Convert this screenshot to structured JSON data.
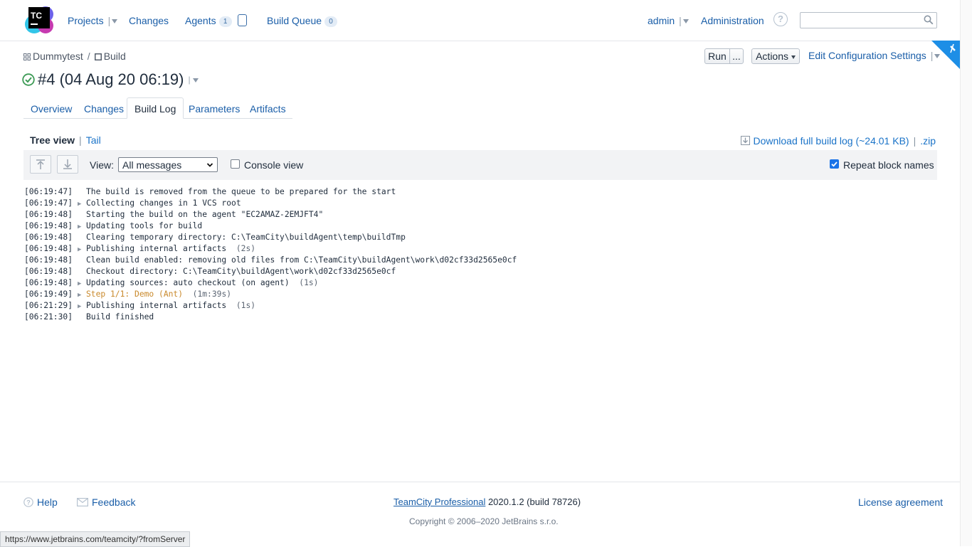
{
  "header": {
    "logo_text": "TC",
    "nav": {
      "projects": "Projects",
      "changes": "Changes",
      "agents": "Agents",
      "agents_count": "1",
      "build_queue": "Build Queue",
      "build_queue_count": "0"
    },
    "user": "admin",
    "administration": "Administration",
    "search": {
      "placeholder": "",
      "value": ""
    }
  },
  "breadcrumb": {
    "project": "Dummytest",
    "separator": "/",
    "build_config": "Build"
  },
  "toolbar_right": {
    "run": "Run",
    "run_more": "...",
    "actions": "Actions",
    "edit_config": "Edit Configuration Settings"
  },
  "build": {
    "title": "#4 (04 Aug 20 06:19)",
    "status": "success"
  },
  "tabs": [
    {
      "label": "Overview",
      "active": false
    },
    {
      "label": "Changes",
      "active": false
    },
    {
      "label": "Build Log",
      "active": true
    },
    {
      "label": "Parameters",
      "active": false
    },
    {
      "label": "Artifacts",
      "active": false
    }
  ],
  "log_view": {
    "tree_view": "Tree view",
    "separator": "|",
    "tail": "Tail",
    "download": "Download full build log (~24.01 KB)",
    "download_sep": "|",
    "zip": ".zip",
    "view_label": "View:",
    "view_selected": "All messages",
    "console_view": "Console view",
    "console_view_checked": false,
    "repeat_block_names": "Repeat block names",
    "repeat_block_names_checked": true
  },
  "log": [
    {
      "ts": "[06:19:47]",
      "expandable": false,
      "msg": "The build is removed from the queue to be prepared for the start",
      "dur": "",
      "step": false
    },
    {
      "ts": "[06:19:47]",
      "expandable": true,
      "msg": "Collecting changes in 1 VCS root",
      "dur": "",
      "step": false
    },
    {
      "ts": "[06:19:48]",
      "expandable": false,
      "msg": "Starting the build on the agent \"EC2AMAZ-2EMJFT4\"",
      "dur": "",
      "step": false
    },
    {
      "ts": "[06:19:48]",
      "expandable": true,
      "msg": "Updating tools for build",
      "dur": "",
      "step": false
    },
    {
      "ts": "[06:19:48]",
      "expandable": false,
      "msg": "Clearing temporary directory: C:\\TeamCity\\buildAgent\\temp\\buildTmp",
      "dur": "",
      "step": false
    },
    {
      "ts": "[06:19:48]",
      "expandable": true,
      "msg": "Publishing internal artifacts",
      "dur": "(2s)",
      "step": false
    },
    {
      "ts": "[06:19:48]",
      "expandable": false,
      "msg": "Clean build enabled: removing old files from C:\\TeamCity\\buildAgent\\work\\d02cf33d2565e0cf",
      "dur": "",
      "step": false
    },
    {
      "ts": "[06:19:48]",
      "expandable": false,
      "msg": "Checkout directory: C:\\TeamCity\\buildAgent\\work\\d02cf33d2565e0cf",
      "dur": "",
      "step": false
    },
    {
      "ts": "[06:19:48]",
      "expandable": true,
      "msg": "Updating sources: auto checkout (on agent)",
      "dur": "(1s)",
      "step": false
    },
    {
      "ts": "[06:19:49]",
      "expandable": true,
      "msg": "Step 1/1: Demo (Ant)",
      "dur": "(1m:39s)",
      "step": true
    },
    {
      "ts": "[06:21:29]",
      "expandable": true,
      "msg": "Publishing internal artifacts",
      "dur": "(1s)",
      "step": false
    },
    {
      "ts": "[06:21:30]",
      "expandable": false,
      "msg": "Build finished",
      "dur": "",
      "step": false
    }
  ],
  "footer": {
    "help": "Help",
    "feedback": "Feedback",
    "product_link": "TeamCity Professional",
    "version": "2020.1.2 (build 78726)",
    "license": "License agreement",
    "copyright": "Copyright © 2006–2020 JetBrains s.r.o."
  },
  "statusbar": {
    "url": "https://www.jetbrains.com/teamcity/?fromServer"
  },
  "colors": {
    "link": "#1a5ea8",
    "success": "#3c9a55",
    "step": "#c9892b",
    "ribbon": "#1d8ee6"
  }
}
